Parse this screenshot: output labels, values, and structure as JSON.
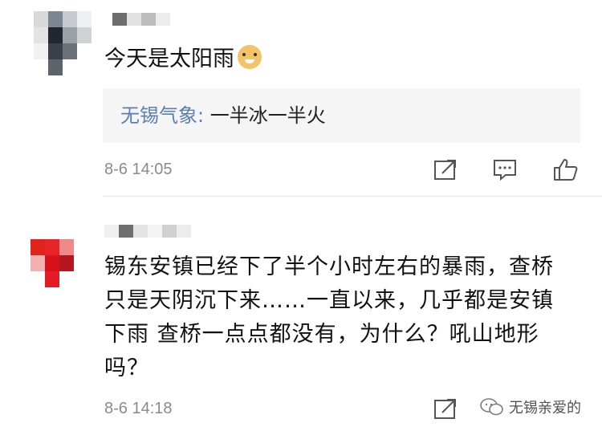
{
  "comments": [
    {
      "text": "今天是太阳雨",
      "emoji": "doge-emoji",
      "quote": {
        "author": "无锡气象:",
        "body": " 一半冰一半火"
      },
      "time": "8-6 14:05",
      "actions": [
        "share-icon",
        "reply-icon",
        "like-icon"
      ]
    },
    {
      "text": "锡东安镇已经下了半个小时左右的暴雨，查桥只是天阴沉下来……一直以来，几乎都是安镇下雨  查桥一点点都没有，为什么？吼山地形吗？",
      "time": "8-6 14:18",
      "actions": [
        "share-icon"
      ]
    }
  ],
  "watermark": {
    "label": "无锡亲爱的",
    "icon": "wechat-icon"
  },
  "colors": {
    "quote_author": "#5b7fb0",
    "time": "#8a8a8a",
    "quote_bg": "#f5f5f5"
  }
}
